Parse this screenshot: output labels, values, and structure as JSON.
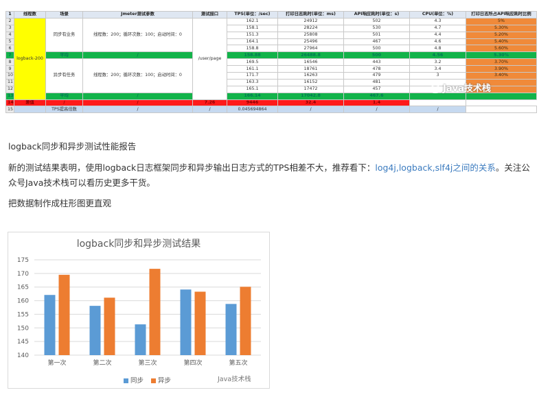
{
  "sheet": {
    "headers": [
      "1",
      "线程数",
      "场景",
      "Jmeter测试参数",
      "测试接口",
      "TPS(单位：/sec)",
      "打印日志耗时(单位：ms)",
      "API响应耗时(单位：s)",
      "CPU(单位：%)",
      "打印日志所占API响应耗时比例"
    ],
    "thread_label": "logback-200",
    "sync_scene": "同步有业务",
    "async_scene": "异步有任务",
    "params": "线程数：200；循环次数：100；启动时间：0",
    "api": "/user/page",
    "sync_rows": [
      {
        "n": "2",
        "tps": "162.1",
        "log": "24912",
        "api": "502",
        "cpu": "4.3",
        "ratio": "5%"
      },
      {
        "n": "3",
        "tps": "158.1",
        "log": "28224",
        "api": "530",
        "cpu": "4.7",
        "ratio": "5.30%"
      },
      {
        "n": "4",
        "tps": "151.3",
        "log": "25808",
        "api": "501",
        "cpu": "4.4",
        "ratio": "5.20%"
      },
      {
        "n": "5",
        "tps": "164.1",
        "log": "25496",
        "api": "467",
        "cpu": "4.6",
        "ratio": "5.40%"
      },
      {
        "n": "6",
        "tps": "158.8",
        "log": "27964",
        "api": "500",
        "cpu": "4.8",
        "ratio": "5.60%"
      }
    ],
    "sync_avg": {
      "n": "7",
      "label": "平均",
      "slash": "/",
      "tps": "158.88",
      "log": "26488.8",
      "api": "500",
      "cpu": "4.56",
      "ratio": "5.30%"
    },
    "async_rows": [
      {
        "n": "8",
        "tps": "169.5",
        "log": "16546",
        "api": "443",
        "cpu": "3.2",
        "ratio": "3.70%"
      },
      {
        "n": "9",
        "tps": "161.1",
        "log": "18761",
        "api": "478",
        "cpu": "3.4",
        "ratio": "3.90%"
      },
      {
        "n": "10",
        "tps": "171.7",
        "log": "16263",
        "api": "479",
        "cpu": "3",
        "ratio": "3.40%"
      },
      {
        "n": "11",
        "tps": "163.3",
        "log": "16152",
        "api": "481",
        "cpu": "",
        "ratio": ""
      },
      {
        "n": "12",
        "tps": "165.1",
        "log": "17472",
        "api": "457",
        "cpu": "",
        "ratio": ""
      }
    ],
    "async_avg": {
      "n": "13",
      "label": "平均",
      "slash": "/",
      "tps": "166.14",
      "log": "17042.8",
      "api": "467.6",
      "cpu": "",
      "ratio": ""
    },
    "diff_row": {
      "n": "14",
      "label": "差值",
      "slash": "/",
      "tps": "7.26",
      "log": "9446",
      "api": "32.4",
      "cpu": "1.4"
    },
    "tps_row": {
      "n": "15",
      "label": "TPS提高倍数",
      "slash": "/",
      "value": "0.045694864"
    }
  },
  "watermark": "Java技术栈",
  "article": {
    "heading": "logback同步和异步测试性能报告",
    "para_before_link": "新的测试结果表明，使用logback日志框架同步和异步输出日志方式的TPS相差不大，推荐看下：",
    "link_text": "log4j,logback,slf4j之间的关系",
    "para_after_link": "。关注公众号Java技术栈可以看历史更多干货。",
    "chart_intro": "把数据制作成柱形图更直观"
  },
  "chart_data": {
    "type": "bar",
    "title": "logback同步和异步测试结果",
    "categories": [
      "第一次",
      "第二次",
      "第三次",
      "第四次",
      "第五次"
    ],
    "series": [
      {
        "name": "同步",
        "color": "#5b9bd5",
        "values": [
          162.1,
          158.1,
          151.3,
          164.1,
          158.8
        ]
      },
      {
        "name": "异步",
        "color": "#ed7d31",
        "values": [
          169.5,
          161.1,
          171.7,
          163.3,
          165.1
        ]
      }
    ],
    "ylim": [
      140,
      175
    ],
    "yticks": [
      140,
      145,
      150,
      155,
      160,
      165,
      170,
      175
    ],
    "grid": true,
    "legend": "bottom",
    "watermark": "Java技术栈"
  }
}
